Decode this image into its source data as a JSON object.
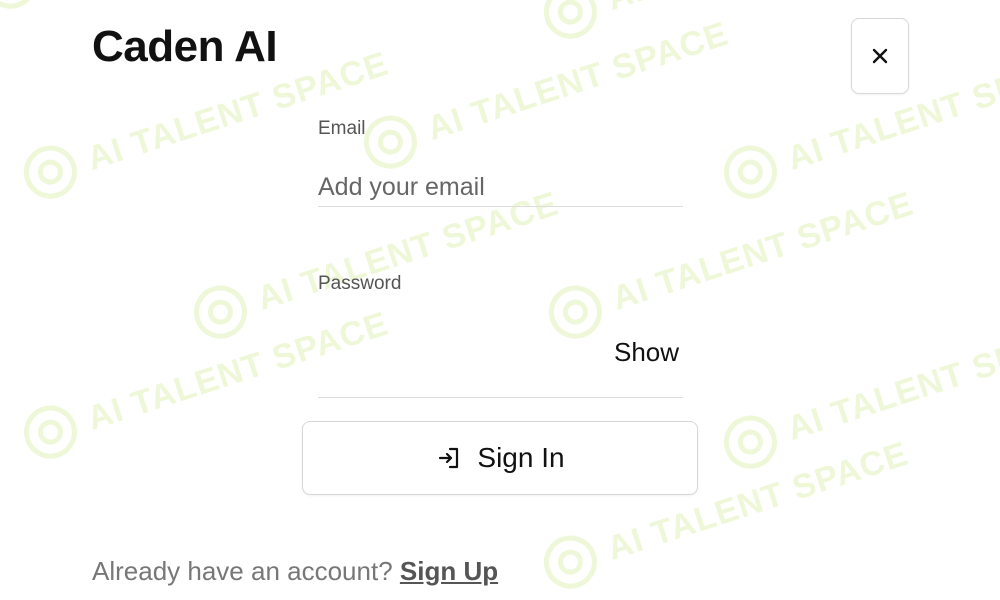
{
  "app": {
    "title": "Caden AI"
  },
  "watermark": {
    "text": "AI TALENT SPACE",
    "color": "#eef8d8"
  },
  "header": {
    "close_icon": "close-icon"
  },
  "form": {
    "email": {
      "label": "Email",
      "placeholder": "Add your email",
      "value": ""
    },
    "password": {
      "label": "Password",
      "value": "",
      "show_label": "Show"
    },
    "sign_in": {
      "label": "Sign In",
      "icon": "sign-in-icon"
    }
  },
  "footer": {
    "prompt": "Already have an account?",
    "link_label": "Sign Up"
  }
}
